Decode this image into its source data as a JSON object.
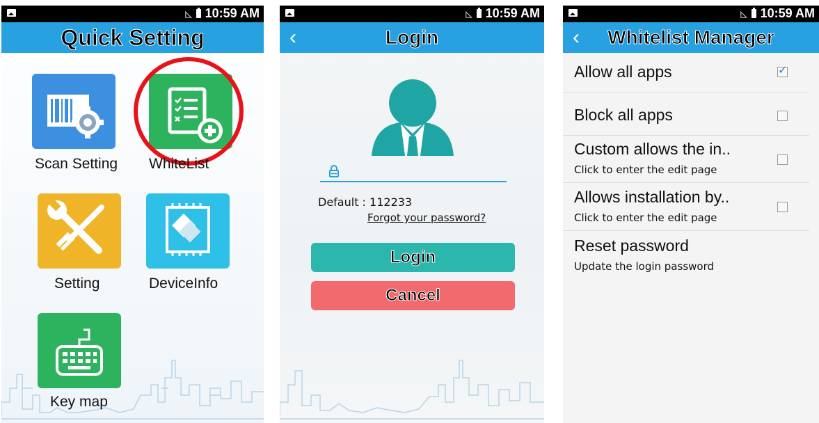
{
  "status_bar": {
    "time": "10:59 AM"
  },
  "quick_setting": {
    "title": "Quick Setting",
    "tiles": [
      {
        "label": "Scan Setting",
        "icon": "barcode-gear-icon",
        "color": "#3d8fe0"
      },
      {
        "label": "WhiteList",
        "icon": "list-add-icon",
        "color": "#2db35e"
      },
      {
        "label": "Setting",
        "icon": "wrench-screwdriver-icon",
        "color": "#f0b429"
      },
      {
        "label": "DeviceInfo",
        "icon": "chip-icon",
        "color": "#2fc0e8"
      },
      {
        "label": "Key map",
        "icon": "keyboard-icon",
        "color": "#2db35e"
      }
    ]
  },
  "login": {
    "title": "Login",
    "password_placeholder": "",
    "default_hint": "Default : 112233",
    "forgot_link": "Forgot your password?",
    "login_button": "Login",
    "cancel_button": "Cancel",
    "colors": {
      "login": "#2bb7ad",
      "cancel": "#f06a6e",
      "avatar": "#1fa5a3"
    }
  },
  "whitelist": {
    "title": "Whitelist Manager",
    "items": [
      {
        "title": "Allow all apps",
        "subtitle": "",
        "checked": true
      },
      {
        "title": "Block all apps",
        "subtitle": "",
        "checked": false
      },
      {
        "title": "Custom allows the in..",
        "subtitle": "Click to enter the edit page",
        "checked": false
      },
      {
        "title": "Allows installation by..",
        "subtitle": "Click to enter the edit page",
        "checked": false
      },
      {
        "title": "Reset password",
        "subtitle": "Update the login password",
        "checked": null
      }
    ]
  }
}
